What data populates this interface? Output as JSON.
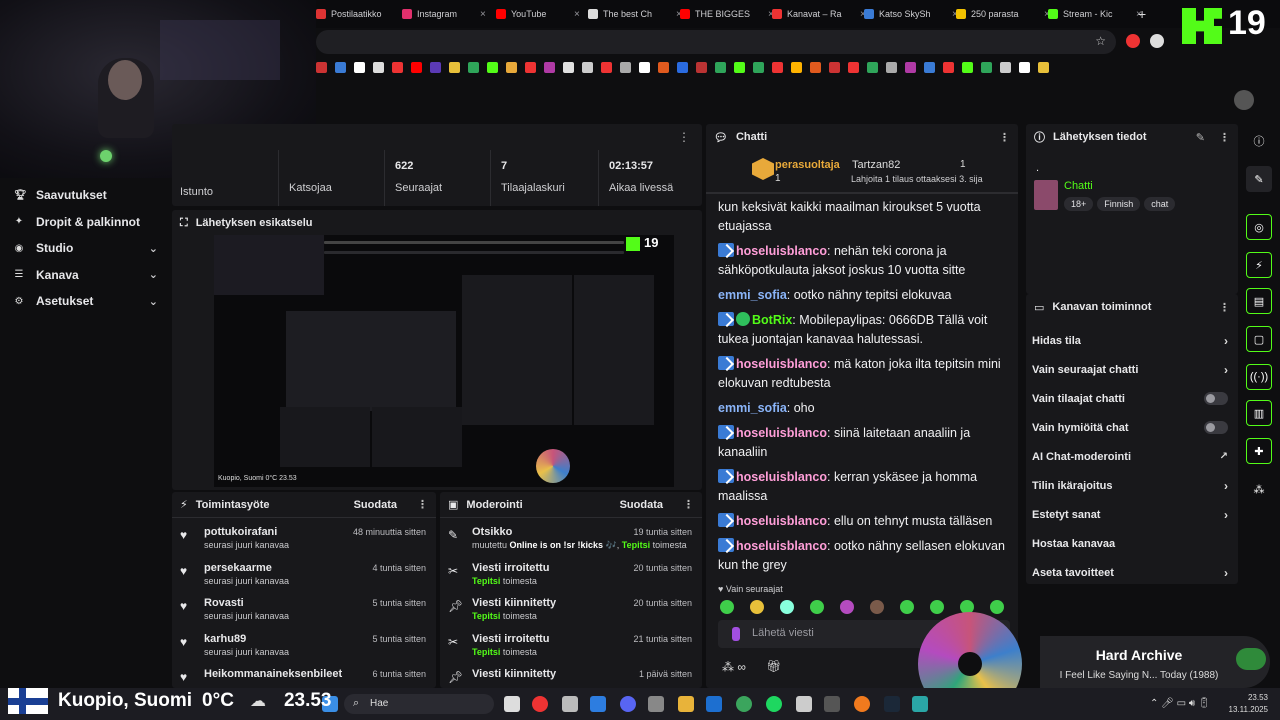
{
  "browser": {
    "tabs": [
      {
        "label": "Postilaatikko",
        "color": "#d33"
      },
      {
        "label": "Instagram",
        "color": "#e1306c"
      },
      {
        "label": "YouTube",
        "color": "#f00"
      },
      {
        "label": "The best Ch",
        "color": "#ddd"
      },
      {
        "label": "THE BIGGES",
        "color": "#f00"
      },
      {
        "label": "Kanavat – Ra",
        "color": "#e33"
      },
      {
        "label": "Katso SkySh",
        "color": "#3a7bd5"
      },
      {
        "label": "250 parasta",
        "color": "#f2c200"
      },
      {
        "label": "Stream - Kic",
        "color": "#53fc18"
      }
    ]
  },
  "kick": {
    "viewer_count": "19"
  },
  "left_nav": {
    "items": [
      {
        "label": "Saavutukset"
      },
      {
        "label": "Dropit & palkinnot"
      },
      {
        "label": "Studio"
      },
      {
        "label": "Kanava"
      },
      {
        "label": "Asetukset"
      }
    ]
  },
  "stats": {
    "session_label": "Istunto",
    "viewers_label": "Katsojaa",
    "followers_value": "622",
    "followers_label": "Seuraajat",
    "subs_value": "7",
    "subs_label": "Tilaajalaskuri",
    "live_value": "02:13:57",
    "live_label": "Aikaa livessä"
  },
  "preview": {
    "title": "Lähetyksen esikatselu",
    "count": "19",
    "overlay_text": "Kuopio, Suomi 0°C  23.53"
  },
  "activity": {
    "title": "Toimintasyöte",
    "filter": "Suodata",
    "items": [
      {
        "name": "pottukoirafani",
        "sub": "seurasi juuri kanavaa",
        "time": "48 minuuttia sitten"
      },
      {
        "name": "persekaarme",
        "sub": "seurasi juuri kanavaa",
        "time": "4 tuntia sitten"
      },
      {
        "name": "Rovasti",
        "sub": "seurasi juuri kanavaa",
        "time": "5 tuntia sitten"
      },
      {
        "name": "karhu89",
        "sub": "seurasi juuri kanavaa",
        "time": "5 tuntia sitten"
      },
      {
        "name": "Heikommanaineksenbileet",
        "sub": "",
        "time": "6 tuntia sitten"
      }
    ]
  },
  "moderation": {
    "title": "Moderointi",
    "filter": "Suodata",
    "items": [
      {
        "name": "Otsikko",
        "sub_pre": "muutettu ",
        "sub_bold": "Online is on !sr !kicks",
        "sub_mid": " 🎶, ",
        "sub_user": "Tepitsi",
        "sub_post": " toimesta",
        "time": "19 tuntia sitten"
      },
      {
        "name": "Viesti irroitettu",
        "sub_user": "Tepitsi",
        "sub_post": " toimesta",
        "time": "20 tuntia sitten"
      },
      {
        "name": "Viesti kiinnitetty",
        "sub_user": "Tepitsi",
        "sub_post": " toimesta",
        "time": "20 tuntia sitten"
      },
      {
        "name": "Viesti irroitettu",
        "sub_user": "Tepitsi",
        "sub_post": " toimesta",
        "time": "21 tuntia sitten"
      },
      {
        "name": "Viesti kiinnitetty",
        "sub_user": "",
        "sub_post": "",
        "time": "1 päivä sitten"
      }
    ]
  },
  "chat": {
    "title": "Chatti",
    "top_gifter": {
      "name": "perasuoltaja",
      "count": "1",
      "second": "Tartzan82",
      "second_count": "1",
      "hint": "Lahjoita 1 tilaus ottaaksesi 3. sija"
    },
    "partial_msg": "kun keksivät kaikki maailman kiroukset 5 vuotta etuajassa",
    "messages": [
      {
        "user": "hoseluisblanco",
        "color": "#ff9ed8",
        "badge": true,
        "verified": false,
        "text": "nehän teki corona ja sähköpotkulauta jaksot joskus 10 vuotta sitte"
      },
      {
        "user": "emmi_sofia",
        "color": "#8ab4f8",
        "badge": false,
        "verified": false,
        "text": "ootko nähny tepitsi elokuvaa"
      },
      {
        "user": "BotRix",
        "color": "#53fc18",
        "badge": true,
        "verified": true,
        "text": "Mobilepaylipas: 0666DB Tällä voit tukea juontajan kanavaa halutessasi."
      },
      {
        "user": "hoseluisblanco",
        "color": "#ff9ed8",
        "badge": true,
        "verified": false,
        "text": "mä katon joka ilta tepitsin mini elokuvan redtubesta"
      },
      {
        "user": "emmi_sofia",
        "color": "#8ab4f8",
        "badge": false,
        "verified": false,
        "text": "oho"
      },
      {
        "user": "hoseluisblanco",
        "color": "#ff9ed8",
        "badge": true,
        "verified": false,
        "text": "siinä laitetaan anaaliin ja kanaaliin"
      },
      {
        "user": "hoseluisblanco",
        "color": "#ff9ed8",
        "badge": true,
        "verified": false,
        "text": "kerran yskäsee ja homma maalissa"
      },
      {
        "user": "hoseluisblanco",
        "color": "#ff9ed8",
        "badge": true,
        "verified": false,
        "text": "ellu on tehnyt musta tälläsen"
      },
      {
        "user": "hoseluisblanco",
        "color": "#ff9ed8",
        "badge": true,
        "verified": false,
        "text": "ootko nähny sellasen elokuvan kun the grey"
      }
    ],
    "followers_only": "Vain seuraajat",
    "input_placeholder": "Lähetä viesti"
  },
  "stream_info": {
    "title": "Lähetyksen tiedot",
    "dot": ".",
    "category": "Chatti",
    "tags": [
      "18+",
      "Finnish",
      "chat"
    ]
  },
  "channel_actions": {
    "title": "Kanavan toiminnot",
    "items": [
      {
        "label": "Hidas tila",
        "kind": "chevron"
      },
      {
        "label": "Vain seuraajat chatti",
        "kind": "chevron"
      },
      {
        "label": "Vain tilaajat chatti",
        "kind": "toggle"
      },
      {
        "label": "Vain hymiöitä chat",
        "kind": "toggle"
      },
      {
        "label": "AI Chat-moderointi",
        "kind": "external"
      },
      {
        "label": "Tilin ikärajoitus",
        "kind": "chevron"
      },
      {
        "label": "Estetyt sanat",
        "kind": "chevron"
      },
      {
        "label": "Hostaa kanavaa",
        "kind": "none"
      },
      {
        "label": "Aseta tavoitteet",
        "kind": "chevron"
      }
    ]
  },
  "now_playing": {
    "title": "Hard Archive",
    "subtitle": "I Feel Like Saying N... Today (1988)"
  },
  "overlay": {
    "location": "Kuopio, Suomi",
    "temp": "0°C",
    "time": "23.53"
  },
  "taskbar": {
    "search": "Hae",
    "clock_time": "23.53",
    "clock_date": "13.11.2025"
  }
}
